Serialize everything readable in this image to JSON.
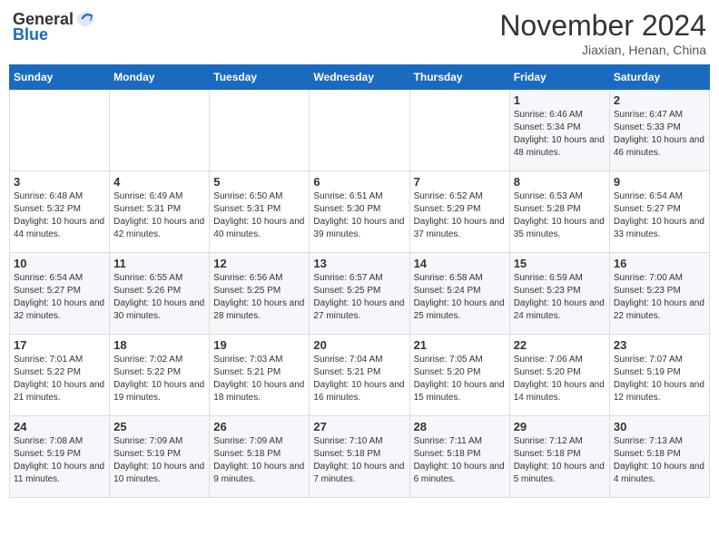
{
  "header": {
    "logo_general": "General",
    "logo_blue": "Blue",
    "title": "November 2024",
    "subtitle": "Jiaxian, Henan, China"
  },
  "days_of_week": [
    "Sunday",
    "Monday",
    "Tuesday",
    "Wednesday",
    "Thursday",
    "Friday",
    "Saturday"
  ],
  "weeks": [
    [
      {
        "day": "",
        "info": ""
      },
      {
        "day": "",
        "info": ""
      },
      {
        "day": "",
        "info": ""
      },
      {
        "day": "",
        "info": ""
      },
      {
        "day": "",
        "info": ""
      },
      {
        "day": "1",
        "info": "Sunrise: 6:46 AM\nSunset: 5:34 PM\nDaylight: 10 hours and 48 minutes."
      },
      {
        "day": "2",
        "info": "Sunrise: 6:47 AM\nSunset: 5:33 PM\nDaylight: 10 hours and 46 minutes."
      }
    ],
    [
      {
        "day": "3",
        "info": "Sunrise: 6:48 AM\nSunset: 5:32 PM\nDaylight: 10 hours and 44 minutes."
      },
      {
        "day": "4",
        "info": "Sunrise: 6:49 AM\nSunset: 5:31 PM\nDaylight: 10 hours and 42 minutes."
      },
      {
        "day": "5",
        "info": "Sunrise: 6:50 AM\nSunset: 5:31 PM\nDaylight: 10 hours and 40 minutes."
      },
      {
        "day": "6",
        "info": "Sunrise: 6:51 AM\nSunset: 5:30 PM\nDaylight: 10 hours and 39 minutes."
      },
      {
        "day": "7",
        "info": "Sunrise: 6:52 AM\nSunset: 5:29 PM\nDaylight: 10 hours and 37 minutes."
      },
      {
        "day": "8",
        "info": "Sunrise: 6:53 AM\nSunset: 5:28 PM\nDaylight: 10 hours and 35 minutes."
      },
      {
        "day": "9",
        "info": "Sunrise: 6:54 AM\nSunset: 5:27 PM\nDaylight: 10 hours and 33 minutes."
      }
    ],
    [
      {
        "day": "10",
        "info": "Sunrise: 6:54 AM\nSunset: 5:27 PM\nDaylight: 10 hours and 32 minutes."
      },
      {
        "day": "11",
        "info": "Sunrise: 6:55 AM\nSunset: 5:26 PM\nDaylight: 10 hours and 30 minutes."
      },
      {
        "day": "12",
        "info": "Sunrise: 6:56 AM\nSunset: 5:25 PM\nDaylight: 10 hours and 28 minutes."
      },
      {
        "day": "13",
        "info": "Sunrise: 6:57 AM\nSunset: 5:25 PM\nDaylight: 10 hours and 27 minutes."
      },
      {
        "day": "14",
        "info": "Sunrise: 6:58 AM\nSunset: 5:24 PM\nDaylight: 10 hours and 25 minutes."
      },
      {
        "day": "15",
        "info": "Sunrise: 6:59 AM\nSunset: 5:23 PM\nDaylight: 10 hours and 24 minutes."
      },
      {
        "day": "16",
        "info": "Sunrise: 7:00 AM\nSunset: 5:23 PM\nDaylight: 10 hours and 22 minutes."
      }
    ],
    [
      {
        "day": "17",
        "info": "Sunrise: 7:01 AM\nSunset: 5:22 PM\nDaylight: 10 hours and 21 minutes."
      },
      {
        "day": "18",
        "info": "Sunrise: 7:02 AM\nSunset: 5:22 PM\nDaylight: 10 hours and 19 minutes."
      },
      {
        "day": "19",
        "info": "Sunrise: 7:03 AM\nSunset: 5:21 PM\nDaylight: 10 hours and 18 minutes."
      },
      {
        "day": "20",
        "info": "Sunrise: 7:04 AM\nSunset: 5:21 PM\nDaylight: 10 hours and 16 minutes."
      },
      {
        "day": "21",
        "info": "Sunrise: 7:05 AM\nSunset: 5:20 PM\nDaylight: 10 hours and 15 minutes."
      },
      {
        "day": "22",
        "info": "Sunrise: 7:06 AM\nSunset: 5:20 PM\nDaylight: 10 hours and 14 minutes."
      },
      {
        "day": "23",
        "info": "Sunrise: 7:07 AM\nSunset: 5:19 PM\nDaylight: 10 hours and 12 minutes."
      }
    ],
    [
      {
        "day": "24",
        "info": "Sunrise: 7:08 AM\nSunset: 5:19 PM\nDaylight: 10 hours and 11 minutes."
      },
      {
        "day": "25",
        "info": "Sunrise: 7:09 AM\nSunset: 5:19 PM\nDaylight: 10 hours and 10 minutes."
      },
      {
        "day": "26",
        "info": "Sunrise: 7:09 AM\nSunset: 5:18 PM\nDaylight: 10 hours and 9 minutes."
      },
      {
        "day": "27",
        "info": "Sunrise: 7:10 AM\nSunset: 5:18 PM\nDaylight: 10 hours and 7 minutes."
      },
      {
        "day": "28",
        "info": "Sunrise: 7:11 AM\nSunset: 5:18 PM\nDaylight: 10 hours and 6 minutes."
      },
      {
        "day": "29",
        "info": "Sunrise: 7:12 AM\nSunset: 5:18 PM\nDaylight: 10 hours and 5 minutes."
      },
      {
        "day": "30",
        "info": "Sunrise: 7:13 AM\nSunset: 5:18 PM\nDaylight: 10 hours and 4 minutes."
      }
    ]
  ]
}
